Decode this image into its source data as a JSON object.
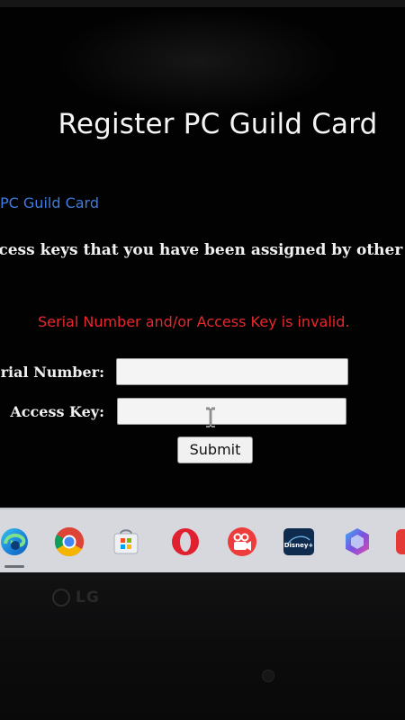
{
  "page": {
    "title": "Register PC Guild Card",
    "breadcrumb_link": "PC Guild Card",
    "instructions": "ccess keys that you have been assigned by other",
    "error": "Serial Number and/or Access Key is invalid."
  },
  "form": {
    "serial_label": "rial Number:",
    "serial_value": "",
    "access_label": "Access Key:",
    "access_value": "",
    "submit_label": "Submit"
  },
  "taskbar": {
    "apps": [
      {
        "name": "edge-icon",
        "active": true
      },
      {
        "name": "chrome-icon"
      },
      {
        "name": "microsoft-store-icon"
      },
      {
        "name": "opera-icon"
      },
      {
        "name": "video-app-icon"
      },
      {
        "name": "disney-plus-icon",
        "text": "Disney+"
      },
      {
        "name": "copilot-icon"
      },
      {
        "name": "red-app-icon"
      }
    ]
  },
  "monitor": {
    "brand": "LG"
  },
  "colors": {
    "link": "#3c7be0",
    "error": "#e8282c",
    "background": "#020202",
    "text": "#f0f0f0",
    "taskbar": "#d6d8dd"
  }
}
